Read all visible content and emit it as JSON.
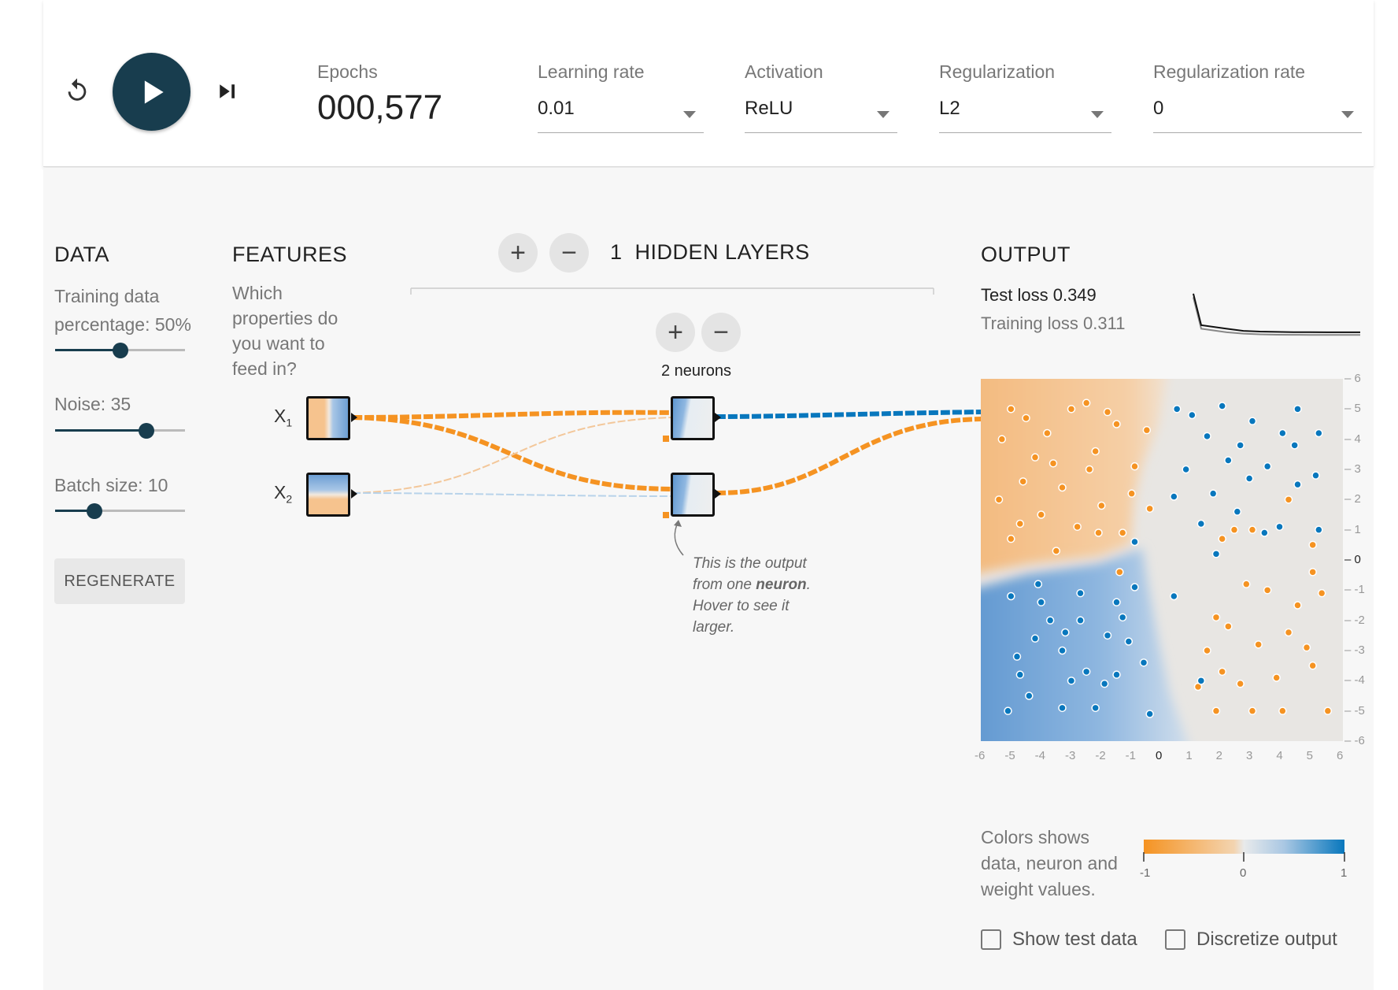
{
  "controls": {
    "epochs_label": "Epochs",
    "epochs_value": "000,577",
    "learning_rate": {
      "label": "Learning rate",
      "value": "0.01"
    },
    "activation": {
      "label": "Activation",
      "value": "ReLU"
    },
    "regularization": {
      "label": "Regularization",
      "value": "L2"
    },
    "regularization_rate": {
      "label": "Regularization rate",
      "value": "0"
    },
    "icons": {
      "reset": "reset-icon",
      "play": "play-icon",
      "step": "step-forward-icon"
    }
  },
  "data_panel": {
    "title": "DATA",
    "train_label_line1": "Training data",
    "train_label_line2": "percentage:",
    "train_value": "50%",
    "train_fraction": 0.5,
    "noise_label": "Noise:",
    "noise_value": "35",
    "noise_fraction": 0.7,
    "batch_label": "Batch size:",
    "batch_value": "10",
    "batch_fraction": 0.3,
    "regenerate": "REGENERATE"
  },
  "features_panel": {
    "title": "FEATURES",
    "desc_lines": [
      "Which",
      "properties do",
      "you want to",
      "feed in?"
    ],
    "features": [
      {
        "main": "X",
        "sub": "1"
      },
      {
        "main": "X",
        "sub": "2"
      }
    ]
  },
  "hidden_layers": {
    "count": "1",
    "label": "HIDDEN LAYERS",
    "neurons_label": "2 neurons",
    "note_line1": "This is the output",
    "note_line2_pre": "from one ",
    "note_line2_bold": "neuron",
    "note_line2_post": ".",
    "note_line3": "Hover to see it",
    "note_line4": "larger."
  },
  "output_panel": {
    "title": "OUTPUT",
    "test_loss_label": "Test loss",
    "test_loss_value": "0.349",
    "training_loss_label": "Training loss",
    "training_loss_value": "0.311",
    "x_ticks": [
      "-6",
      "-5",
      "-4",
      "-3",
      "-2",
      "-1",
      "0",
      "1",
      "2",
      "3",
      "4",
      "5",
      "6"
    ],
    "y_ticks": [
      "6",
      "5",
      "4",
      "3",
      "2",
      "1",
      "0",
      "-1",
      "-2",
      "-3",
      "-4",
      "-5",
      "-6"
    ],
    "legend_lines": [
      "Colors shows",
      "data, neuron and",
      "weight values."
    ],
    "colorbar_ticks": [
      "-1",
      "0",
      "1"
    ],
    "show_test_data": "Show test data",
    "discretize_output": "Discretize output"
  },
  "colors": {
    "orange": "#f59322",
    "blue": "#0877bd",
    "dark": "#183d4e",
    "light": "#e8eaeb"
  },
  "chart_data": {
    "type": "scatter",
    "xlim": [
      -6,
      6
    ],
    "ylim": [
      -6,
      6
    ],
    "series": [
      {
        "values": [
          [
            -5,
            5
          ],
          [
            -4.5,
            4.7
          ],
          [
            -3,
            5
          ],
          [
            -2.5,
            5.2
          ],
          [
            -1.5,
            4.5
          ],
          [
            -5.3,
            4
          ],
          [
            -4.2,
            3.4
          ],
          [
            -3.6,
            3.2
          ],
          [
            -2.2,
            3.6
          ],
          [
            -0.5,
            4.3
          ],
          [
            -4.6,
            2.6
          ],
          [
            -3.3,
            2.4
          ],
          [
            -2,
            1.8
          ],
          [
            -1,
            2.2
          ],
          [
            -5.4,
            2
          ],
          [
            -4,
            1.5
          ],
          [
            -2.8,
            1.1
          ],
          [
            -1.3,
            0.9
          ],
          [
            -0.4,
            1.7
          ],
          [
            -5,
            0.7
          ],
          [
            -3.5,
            0.3
          ],
          [
            -2.1,
            0.9
          ],
          [
            -1.4,
            -0.4
          ],
          [
            -4.7,
            1.2
          ],
          [
            -2.4,
            3
          ],
          [
            -0.9,
            3.1
          ],
          [
            -3.8,
            4.2
          ],
          [
            -1.8,
            4.9
          ],
          [
            1.5,
            -3
          ],
          [
            2.2,
            -2.2
          ],
          [
            3.2,
            -2.8
          ],
          [
            4.5,
            -1.5
          ],
          [
            5,
            -0.4
          ],
          [
            1.2,
            -4.2
          ],
          [
            2.6,
            -4.1
          ],
          [
            3.8,
            -3.9
          ],
          [
            4.8,
            -2.9
          ],
          [
            5.3,
            -1.1
          ],
          [
            2,
            -3.7
          ],
          [
            3.5,
            -1
          ],
          [
            4.2,
            -2.4
          ],
          [
            1.8,
            -1.9
          ],
          [
            2.8,
            -0.8
          ],
          [
            5,
            -3.5
          ],
          [
            4,
            -5
          ],
          [
            3,
            -5
          ],
          [
            5.5,
            -5
          ],
          [
            1.8,
            -5
          ],
          [
            2.4,
            1
          ],
          [
            3,
            1
          ],
          [
            4.2,
            2
          ],
          [
            5,
            0.5
          ],
          [
            2,
            0.7
          ]
        ]
      },
      {
        "values": [
          [
            0.5,
            5
          ],
          [
            1,
            4.8
          ],
          [
            2,
            5.1
          ],
          [
            3,
            4.6
          ],
          [
            4.5,
            5
          ],
          [
            5.2,
            4.2
          ],
          [
            1.5,
            4.1
          ],
          [
            2.6,
            3.8
          ],
          [
            3.5,
            3.1
          ],
          [
            4.5,
            2.5
          ],
          [
            0.8,
            3
          ],
          [
            1.7,
            2.2
          ],
          [
            2.5,
            1.6
          ],
          [
            3.4,
            0.9
          ],
          [
            1.3,
            1.2
          ],
          [
            2.9,
            2.7
          ],
          [
            4,
            4.2
          ],
          [
            5.1,
            2.8
          ],
          [
            0.4,
            2.1
          ],
          [
            2.2,
            3.3
          ],
          [
            5.2,
            1
          ],
          [
            3.9,
            1.1
          ],
          [
            1.8,
            0.2
          ],
          [
            4.4,
            3.8
          ],
          [
            -0.9,
            -0.9
          ],
          [
            -1.5,
            -1.4
          ],
          [
            -2.7,
            -2
          ],
          [
            -4,
            -1.4
          ],
          [
            -5,
            -1.2
          ],
          [
            -3.3,
            -3
          ],
          [
            -4.8,
            -3.2
          ],
          [
            -1.8,
            -2.5
          ],
          [
            -0.6,
            -3.4
          ],
          [
            -3,
            -4
          ],
          [
            -4.4,
            -4.5
          ],
          [
            -5.1,
            -5
          ],
          [
            -2.2,
            -4.9
          ],
          [
            -1.1,
            -2.7
          ],
          [
            -3.7,
            -2
          ],
          [
            -2.5,
            -3.7
          ],
          [
            -4.2,
            -2.6
          ],
          [
            -1.9,
            -4.1
          ],
          [
            -0.4,
            -5.1
          ],
          [
            -4.1,
            -0.8
          ],
          [
            -1.3,
            -1.9
          ],
          [
            -3.2,
            -2.4
          ],
          [
            -2.7,
            -1.1
          ],
          [
            -4.7,
            -3.8
          ],
          [
            -3.3,
            -4.9
          ],
          [
            -1.5,
            -3.8
          ],
          [
            1.3,
            -4
          ],
          [
            0.4,
            -1.2
          ],
          [
            -0.9,
            0.6
          ]
        ]
      }
    ],
    "test_loss_curve": [
      0.9,
      0.45,
      0.4,
      0.37,
      0.36,
      0.355,
      0.352,
      0.351,
      0.35,
      0.349,
      0.349
    ],
    "train_loss_curve": [
      0.85,
      0.4,
      0.35,
      0.33,
      0.32,
      0.315,
      0.313,
      0.312,
      0.311,
      0.311,
      0.311
    ]
  }
}
